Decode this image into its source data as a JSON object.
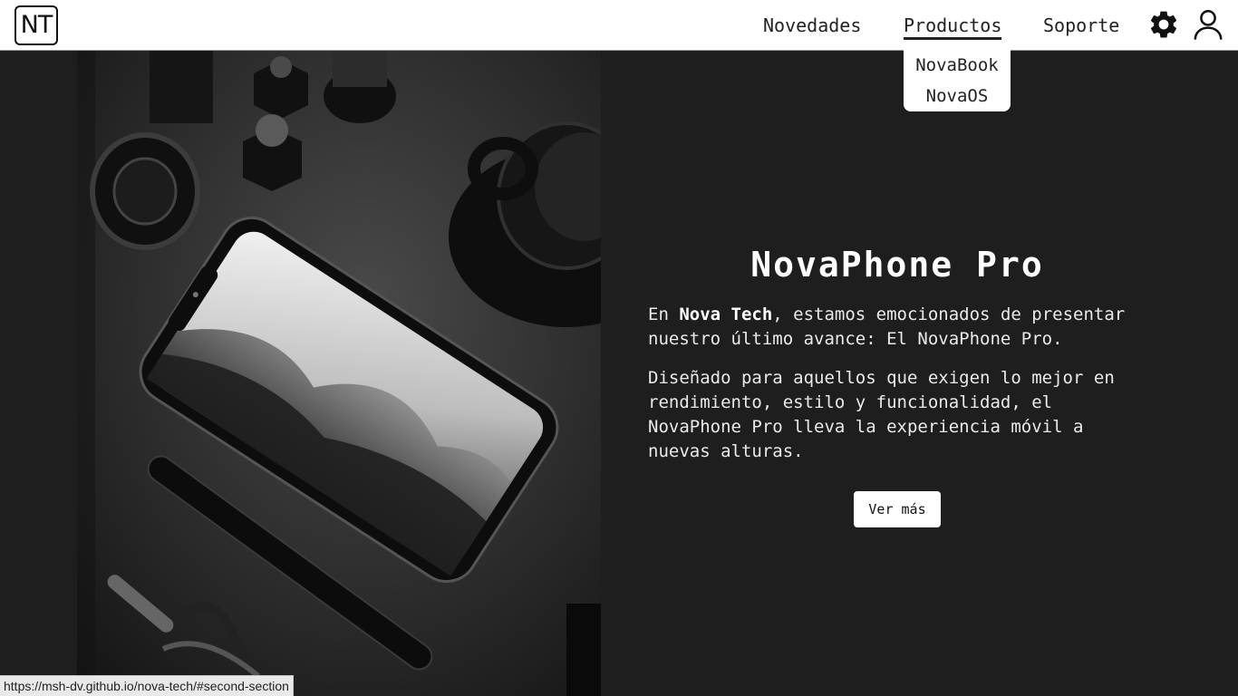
{
  "nav": {
    "logo": "NT",
    "links": [
      "Novedades",
      "Productos",
      "Soporte"
    ],
    "active": "Productos",
    "icons": [
      "gear-icon",
      "user-icon"
    ]
  },
  "dropdown": {
    "items": [
      "NovaBook",
      "NovaOS"
    ]
  },
  "hero": {
    "title": "NovaPhone Pro",
    "p1_prefix": "En ",
    "p1_bold": "Nova Tech",
    "p1_suffix": ", estamos emocionados de presentar nuestro último avance: El NovaPhone Pro.",
    "p2": "Diseñado para aquellos que exigen lo mejor en rendimiento, estilo y funcionalidad, el NovaPhone Pro lleva la experiencia móvil a nuevas alturas.",
    "button": "Ver más"
  },
  "status_url": "https://msh-dv.github.io/nova-tech/#second-section",
  "colors": {
    "background": "#1e1e1e",
    "header": "#ffffff",
    "text": "#f2f2f2"
  }
}
